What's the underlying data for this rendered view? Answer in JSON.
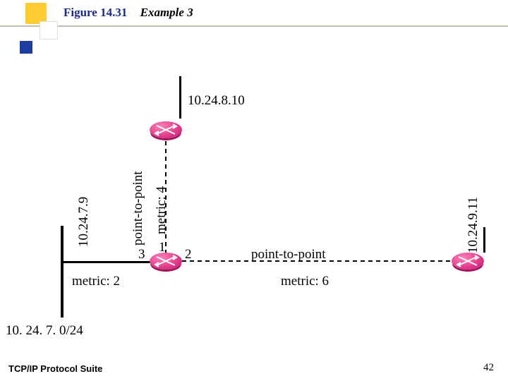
{
  "title": {
    "fig": "Figure 14.31",
    "sub": "Example 3"
  },
  "footer": {
    "left": "TCP/IP Protocol Suite",
    "page": "42"
  },
  "nodes": {
    "top": {
      "ip": "10.24.8.10"
    },
    "center": {},
    "right": {
      "ip": "10.24.9.11"
    }
  },
  "links": {
    "top_center": {
      "type": "point-to-point",
      "metric_label": "metric: 4"
    },
    "center_right": {
      "type": "point-to-point",
      "metric_label": "metric: 6"
    },
    "left_net": {
      "ip": "10.24.7.9",
      "metric_label": "metric: 2",
      "network": "10. 24. 7. 0/24"
    }
  },
  "ports": {
    "up": "1",
    "left": "3",
    "right": "2"
  }
}
